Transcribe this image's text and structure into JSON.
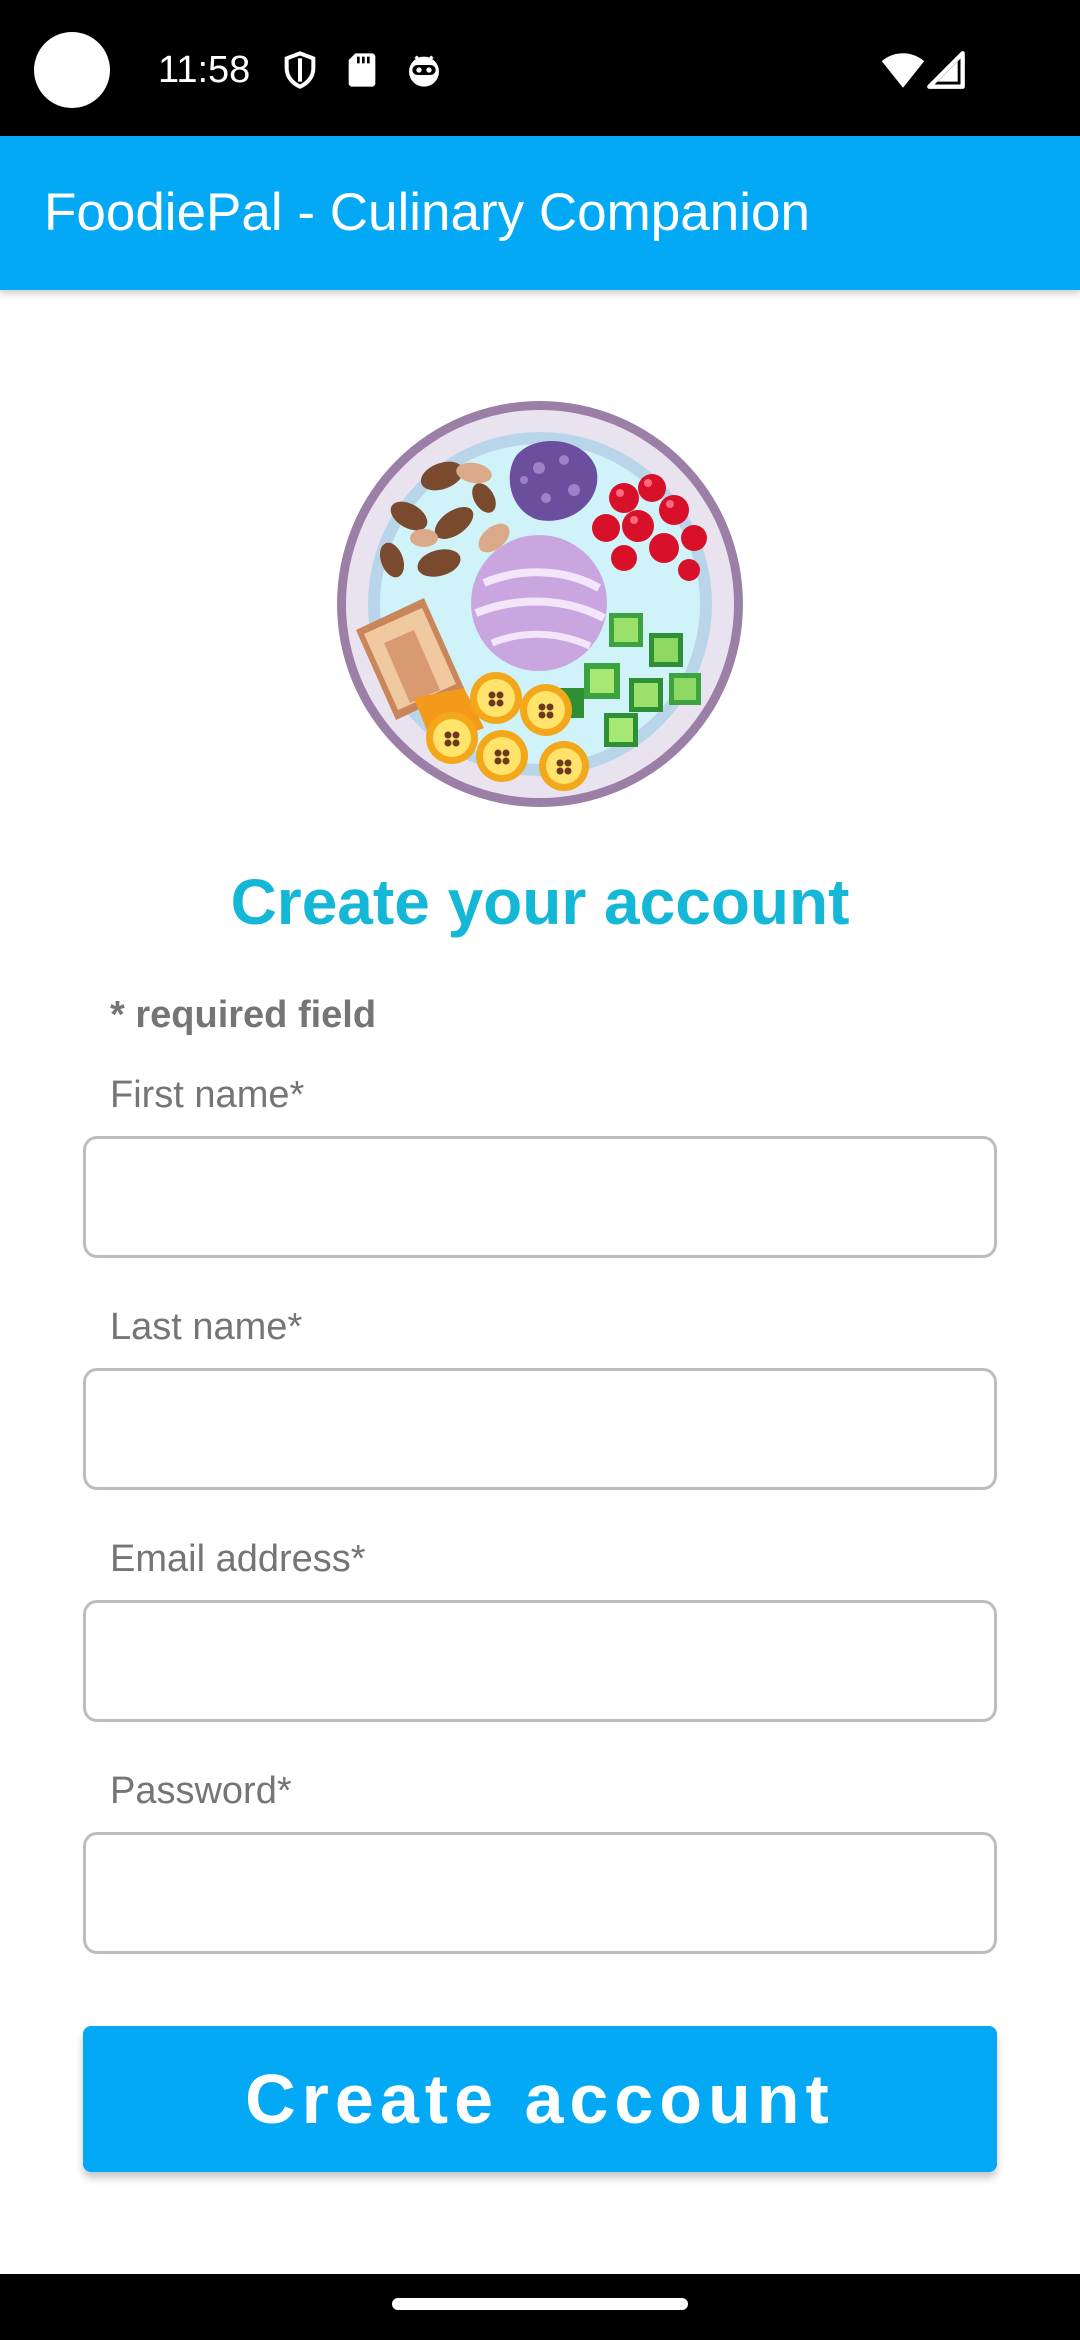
{
  "status_bar": {
    "time": "11:58",
    "icons_left": [
      "shield-icon",
      "sd-card-icon",
      "android-head-icon"
    ],
    "icons_right": [
      "wifi-icon",
      "cell-signal-icon"
    ]
  },
  "app_bar": {
    "title": "FoodiePal - Culinary Companion",
    "color": "#03A9F4"
  },
  "logo": {
    "icon": "food-bowl-logo-icon"
  },
  "form": {
    "heading": "Create your account",
    "heading_color": "#14B8D6",
    "required_note": "* required field",
    "fields": [
      {
        "label": "First name*",
        "value": "",
        "placeholder": ""
      },
      {
        "label": "Last name*",
        "value": "",
        "placeholder": ""
      },
      {
        "label": "Email address*",
        "value": "",
        "placeholder": ""
      },
      {
        "label": "Password*",
        "value": "",
        "placeholder": ""
      }
    ],
    "submit_label": "Create account"
  },
  "nav_bar": {
    "home_indicator": "home-indicator"
  }
}
